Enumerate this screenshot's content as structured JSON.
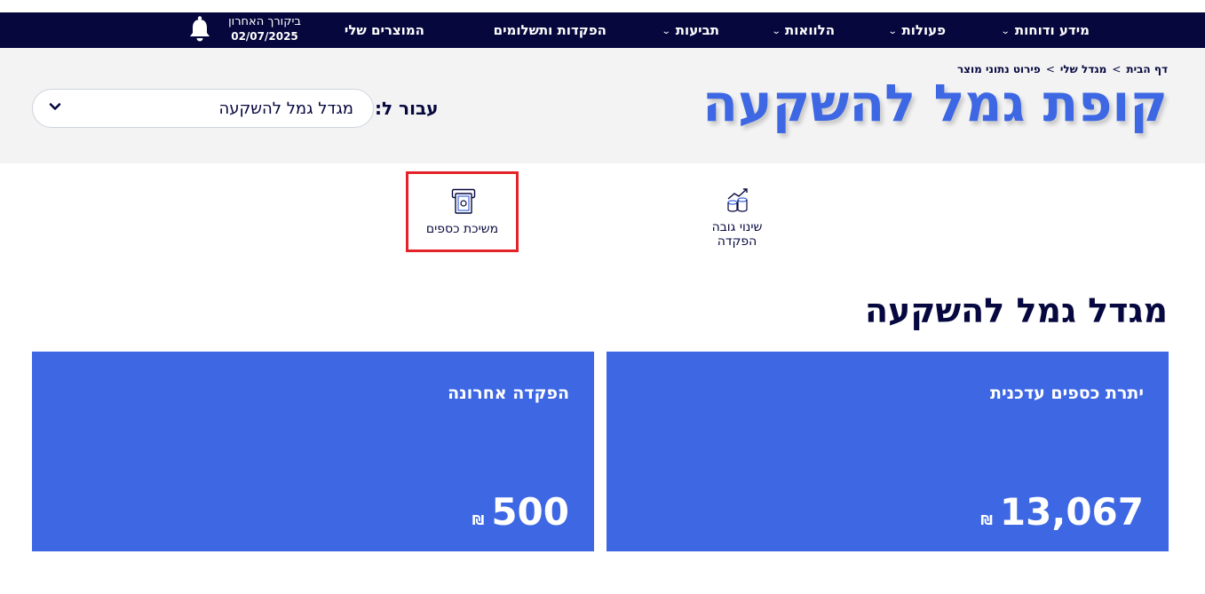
{
  "nav": {
    "items": [
      {
        "label": "מידע ודוחות",
        "has_menu": true
      },
      {
        "label": "פעולות",
        "has_menu": true
      },
      {
        "label": "הלוואות",
        "has_menu": true
      },
      {
        "label": "תביעות",
        "has_menu": true
      },
      {
        "label": "הפקדות ותשלומים",
        "has_menu": false
      },
      {
        "label": "המוצרים שלי",
        "has_menu": false
      }
    ],
    "last_visit_label": "ביקורך האחרון",
    "last_visit_date": "02/07/2025",
    "bell_icon": "bell-icon"
  },
  "breadcrumb": {
    "items": [
      "דף הבית",
      "מגדל שלי",
      "פירוט נתוני מוצר"
    ],
    "separator": ">"
  },
  "hero": {
    "title": "קופת גמל להשקעה",
    "for_label": "עבור ל:",
    "select_value": "מגדל גמל להשקעה"
  },
  "actions": {
    "withdraw": {
      "label": "משיכת כספים",
      "icon": "cash-withdraw-icon"
    },
    "deposit_change": {
      "label_line1": "שינוי גובה",
      "label_line2": "הפקדה",
      "icon": "coins-growth-icon"
    }
  },
  "section": {
    "title": "מגדל גמל להשקעה"
  },
  "cards": {
    "balance": {
      "title": "יתרת כספים עדכנית",
      "amount": "13,067",
      "currency": "₪"
    },
    "last_deposit": {
      "title": "הפקדה אחרונה",
      "amount": "500",
      "currency": "₪"
    }
  },
  "colors": {
    "navbar": "#06073d",
    "accent": "#3d67e3",
    "highlight_border": "#e3232a",
    "hero_bg": "#f3f3f3"
  }
}
